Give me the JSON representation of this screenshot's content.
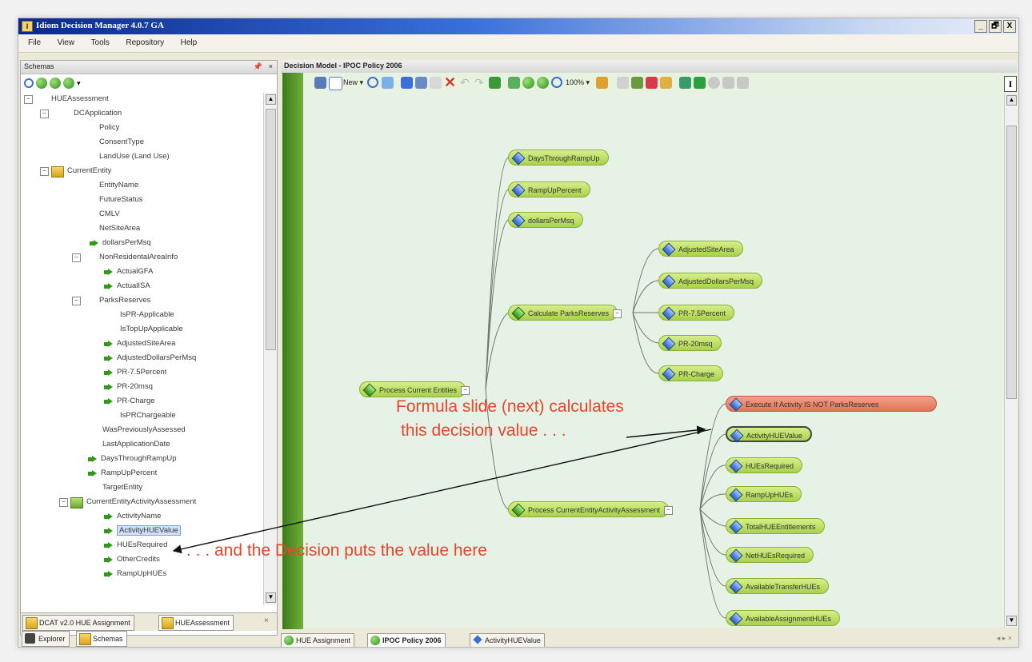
{
  "window": {
    "title": "Idiom Decision Manager 4.0.7 GA",
    "buttons": [
      "_",
      "🗗",
      "X"
    ]
  },
  "menu": [
    "File",
    "View",
    "Tools",
    "Repository",
    "Help"
  ],
  "left_panel": {
    "title": "Schemas",
    "pin": "📌",
    "close": "×",
    "tree": [
      {
        "label": "HUEAssessment",
        "expander": "⊟"
      },
      {
        "label": "DCApplication",
        "expander": "⊟"
      },
      {
        "label": "Policy"
      },
      {
        "label": "ConsentType"
      },
      {
        "label": "LandUse (Land Use)"
      },
      {
        "label": "CurrentEntity",
        "expander": "⊟"
      },
      {
        "label": "EntityName"
      },
      {
        "label": "FutureStatus"
      },
      {
        "label": "CMLV"
      },
      {
        "label": "NetSiteArea"
      },
      {
        "label": "dollarsPerMsq"
      },
      {
        "label": "NonResidentalAreaInfo",
        "expander": "⊟"
      },
      {
        "label": "ActualGFA"
      },
      {
        "label": "ActualISA"
      },
      {
        "label": "ParksReserves",
        "expander": "⊟"
      },
      {
        "label": "IsPR-Applicable"
      },
      {
        "label": "IsTopUpApplicable"
      },
      {
        "label": "AdjustedSiteArea"
      },
      {
        "label": "AdjustedDollarsPerMsq"
      },
      {
        "label": "PR-7.5Percent"
      },
      {
        "label": "PR-20msq"
      },
      {
        "label": "PR-Charge"
      },
      {
        "label": "IsPRChargeable"
      },
      {
        "label": "WasPreviouslyAssessed"
      },
      {
        "label": "LastApplicationDate"
      },
      {
        "label": "DaysThroughRampUp"
      },
      {
        "label": "RampUpPercent"
      },
      {
        "label": "TargetEntity"
      },
      {
        "label": "CurrentEntityActivityAssessment",
        "expander": "⊟"
      },
      {
        "label": "ActivityName"
      },
      {
        "label": "ActivityHUEValue"
      },
      {
        "label": "HUEsRequired"
      },
      {
        "label": "OtherCredits"
      },
      {
        "label": "RampUpHUEs"
      }
    ],
    "tabs": [
      "DCAT v2.0 HUE Assignment",
      "HUEAssessment"
    ],
    "bottom_tabs": [
      "Explorer",
      "Schemas"
    ]
  },
  "right_panel": {
    "title": "Decision Model - IPOC Policy 2006",
    "toolbar": {
      "new_label": "New ▾",
      "zoom_label": "100% ▾"
    },
    "nodes": {
      "days": "DaysThroughRampUp",
      "ramp": "RampUpPercent",
      "dollars": "dollarsPerMsq",
      "calc_parks": "Calculate ParksReserves",
      "adj_site": "AdjustedSiteArea",
      "adj_dollars": "AdjustedDollarsPerMsq",
      "pr75": "PR-7.5Percent",
      "pr20": "PR-20msq",
      "prcharge": "PR-Charge",
      "process_current": "Process Current Entities",
      "execute_if": "Execute If Activity IS NOT ParksReserves",
      "activity_hue": "ActivityHUEValue",
      "hues_req": "HUEsRequired",
      "rampup_hues": "RampUpHUEs",
      "total_hue": "TotalHUEEntitlements",
      "net_hues": "NetHUEsRequired",
      "process_activity": "Process CurrentEntityActivityAssessment",
      "avail_transfer": "AvailableTransferHUEs",
      "avail_assign": "AvailableAssignmentHUEs"
    },
    "bottom_tabs": [
      "HUE Assignment",
      "IPOC Policy 2006",
      "ActivityHUEValue"
    ],
    "nav": "◂ ▸ ×"
  },
  "annotations": {
    "formula_line1": "Formula slide (next) calculates",
    "formula_line2": "this decision value . . .",
    "decision_puts": ". . . and the Decision puts the value here"
  },
  "colors": {
    "accent_green": "#a8d24a",
    "annotation_red": "#e8462a",
    "execute_node": "#e07458"
  }
}
